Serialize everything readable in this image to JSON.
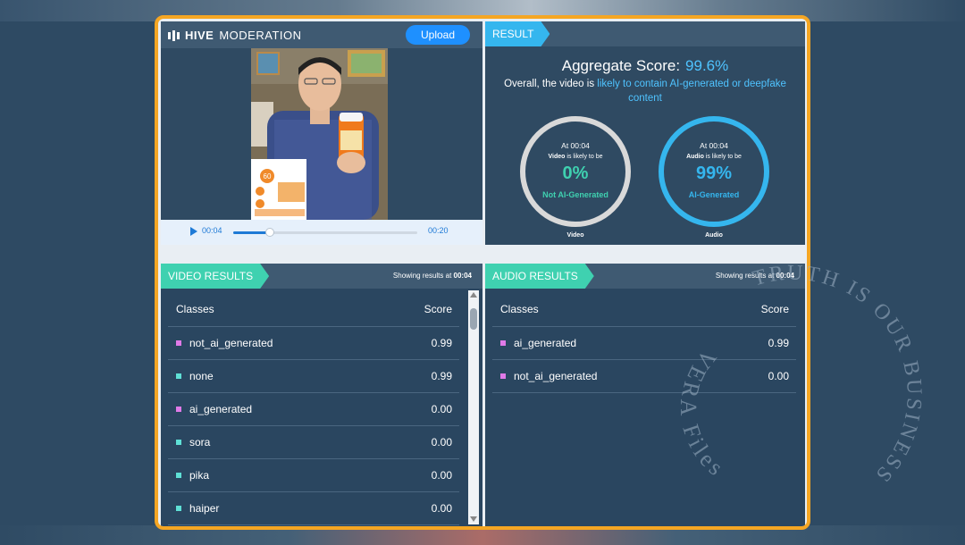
{
  "colors": {
    "accent_orange": "#f5a623",
    "ai_blue": "#35b6ee",
    "human_green": "#3fd1b0",
    "ai_class": "#e07ae8",
    "not_ai_class": "#5fe0d6"
  },
  "app": {
    "logo_bold": "HIVE",
    "logo_light": "MODERATION",
    "upload_label": "Upload"
  },
  "player": {
    "current_time": "00:04",
    "duration": "00:20",
    "progress": 0.2,
    "thumbnail_product_text": "60"
  },
  "result": {
    "tag": "RESULT",
    "aggregate_label": "Aggregate Score:",
    "aggregate_value": "99.6%",
    "summary_prefix": "Overall, the video is",
    "summary_highlight": "likely to contain AI-generated or deepfake content",
    "video_gauge": {
      "at": "At 00:04",
      "subject": "Video",
      "likely": "is likely to be",
      "pct": "0%",
      "class": "Not AI-Generated",
      "caption": "Video"
    },
    "audio_gauge": {
      "at": "At 00:04",
      "subject": "Audio",
      "likely": "is likely to be",
      "pct": "99%",
      "class": "AI-Generated",
      "caption": "Audio"
    }
  },
  "video_results": {
    "tag": "VIDEO RESULTS",
    "showing_prefix": "Showing results at",
    "showing_time": "00:04",
    "col_classes": "Classes",
    "col_score": "Score",
    "rows": [
      {
        "name": "not_ai_generated",
        "score": "0.99",
        "color": "#e07ae8"
      },
      {
        "name": "none",
        "score": "0.99",
        "color": "#5fe0d6"
      },
      {
        "name": "ai_generated",
        "score": "0.00",
        "color": "#e07ae8"
      },
      {
        "name": "sora",
        "score": "0.00",
        "color": "#5fe0d6"
      },
      {
        "name": "pika",
        "score": "0.00",
        "color": "#5fe0d6"
      },
      {
        "name": "haiper",
        "score": "0.00",
        "color": "#5fe0d6"
      }
    ]
  },
  "audio_results": {
    "tag": "AUDIO RESULTS",
    "showing_prefix": "Showing results at",
    "showing_time": "00:04",
    "col_classes": "Classes",
    "col_score": "Score",
    "rows": [
      {
        "name": "ai_generated",
        "score": "0.99",
        "color": "#e07ae8"
      },
      {
        "name": "not_ai_generated",
        "score": "0.00",
        "color": "#e07ae8"
      }
    ]
  },
  "watermark": {
    "top_text": "TRUTH IS OUR BUSINESS",
    "inner_text": "VERA Files"
  }
}
